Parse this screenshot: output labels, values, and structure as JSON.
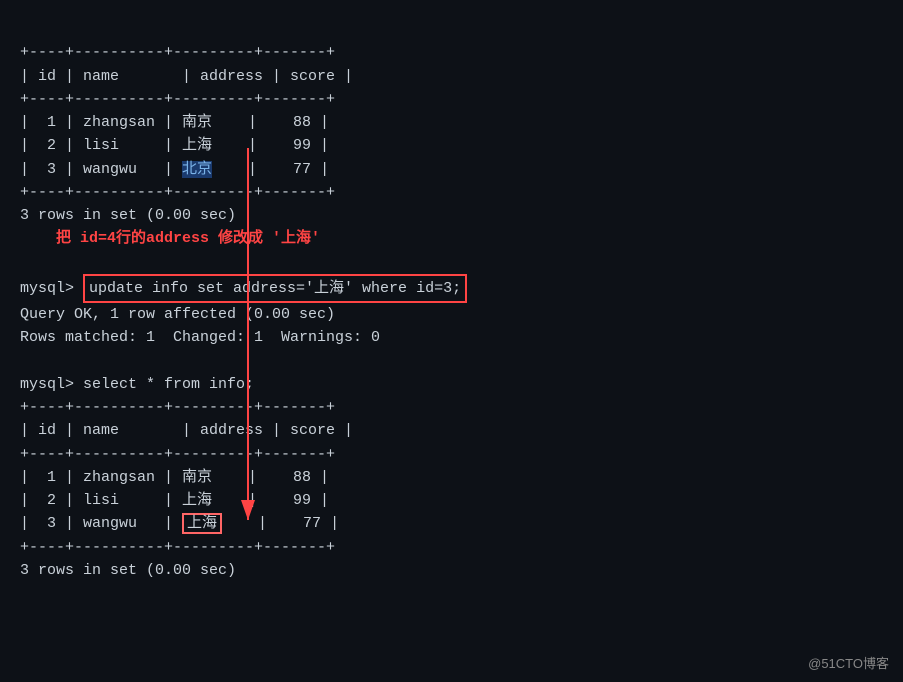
{
  "terminal": {
    "bg": "#0d1117",
    "lines": {
      "header_sep": "+------+----------+-----------+---------+",
      "header_row": "| id | name       | address | score |",
      "data_sep": "+------+----------+-----------+---------+",
      "row1": "|  1 | zhangsan | 南京      |    88 |",
      "row2": "|  2 | lisi     | 上海      |    99 |",
      "row3_before": "|  3 | wangwu   |",
      "row3_addr_before": "北京",
      "row3_after": "|    77 |",
      "bottom_sep": "+------+----------+-----------+---------+",
      "rows_count": "3 rows in set (0.00 sec)",
      "annotation": "把 id=4行的address 修改成 '上海'",
      "prompt": "mysql>",
      "update_cmd": "update info set address='上海' where id=3;",
      "query_ok": "Query OK, 1 row affected (0.00 sec)",
      "rows_matched": "Rows matched: 1  Changed: 1  Warnings: 0",
      "select_cmd": "select * from info;",
      "row3_addr_after": "上海",
      "rows_count2": "3 rows in set (0.00 sec)"
    }
  },
  "watermark": "@51CTO博客"
}
